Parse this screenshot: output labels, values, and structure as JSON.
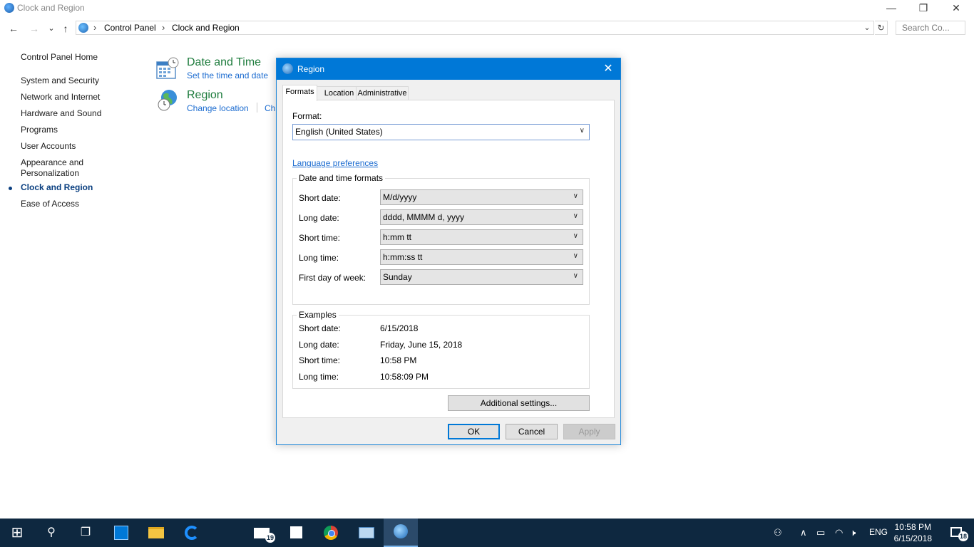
{
  "window": {
    "title": "Clock and Region",
    "min_glyph": "—",
    "restore_glyph": "❐",
    "close_glyph": "✕"
  },
  "nav": {
    "back_glyph": "←",
    "forward_glyph": "→",
    "recent_glyph": "⌄",
    "up_glyph": "↑"
  },
  "address": {
    "sep1": "›",
    "crumb1": "Control Panel",
    "sep2": "›",
    "crumb2": "Clock and Region",
    "dropdown_glyph": "⌄",
    "refresh_glyph": "↻"
  },
  "search": {
    "placeholder": "Search Co..."
  },
  "sidebar": {
    "home": "Control Panel Home",
    "items": [
      "System and Security",
      "Network and Internet",
      "Hardware and Sound",
      "Programs",
      "User Accounts",
      "Appearance and",
      "Personalization",
      "Clock and Region",
      "Ease of Access"
    ]
  },
  "content": {
    "datetime_heading": "Date and Time",
    "datetime_link": "Set the time and date",
    "region_heading": "Region",
    "region_link1": "Change location",
    "region_link2_partial": "Ch"
  },
  "dialog": {
    "title": "Region",
    "close_glyph": "✕",
    "tabs": [
      "Formats",
      "Location",
      "Administrative"
    ],
    "format_label": "Format:",
    "format_value": "English (United States)",
    "language_link": "Language preferences",
    "dt_group_title": "Date and time formats",
    "dt_rows": [
      {
        "label": "Short date:",
        "value": "M/d/yyyy"
      },
      {
        "label": "Long date:",
        "value": "dddd, MMMM d, yyyy"
      },
      {
        "label": "Short time:",
        "value": "h:mm tt"
      },
      {
        "label": "Long time:",
        "value": "h:mm:ss tt"
      },
      {
        "label": "First day of week:",
        "value": "Sunday"
      }
    ],
    "examples_title": "Examples",
    "examples": [
      {
        "label": "Short date:",
        "value": "6/15/2018"
      },
      {
        "label": "Long date:",
        "value": "Friday, June 15, 2018"
      },
      {
        "label": "Short time:",
        "value": "10:58 PM"
      },
      {
        "label": "Long time:",
        "value": "10:58:09 PM"
      }
    ],
    "additional_settings": "Additional settings...",
    "ok": "OK",
    "cancel": "Cancel",
    "apply": "Apply",
    "combo_arrow": "∨"
  },
  "taskbar": {
    "start_glyph": "⊞",
    "search_glyph": "⚲",
    "taskview_glyph": "❐",
    "mail_badge": "19",
    "people_glyph": "⚇",
    "tray_chevron": "∧",
    "battery_glyph": "▭",
    "wifi_glyph": "◠",
    "volume_glyph": "🕨",
    "lang": "ENG",
    "time": "10:58 PM",
    "date": "6/15/2018",
    "notif_badge": "18"
  },
  "colors": {
    "accent": "#0078d7",
    "taskbar": "#0e2840",
    "heading_green": "#1e7c3d",
    "link_blue": "#1c6cd0"
  }
}
